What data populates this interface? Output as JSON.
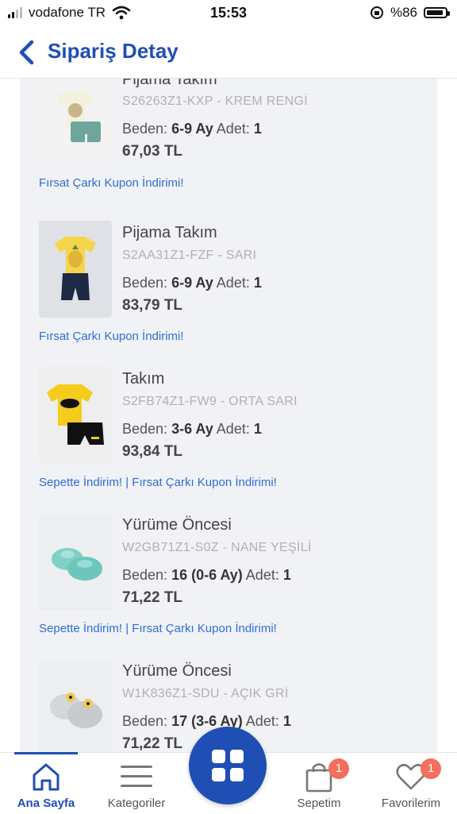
{
  "status_bar": {
    "carrier": "vodafone TR",
    "time": "15:53",
    "battery": "%86"
  },
  "header": {
    "title": "Sipariş Detay"
  },
  "labels": {
    "size": "Beden:",
    "qty": "Adet:"
  },
  "items": [
    {
      "name": "Pijama Takım",
      "sku": "S26263Z1-KXP - KREM RENGİ",
      "size": "6-9 Ay",
      "qty": "1",
      "price": "67,03 TL",
      "promo": "Fırsat Çarkı Kupon İndirimi!",
      "image": "pajama-cream"
    },
    {
      "name": "Pijama Takım",
      "sku": "S2AA31Z1-FZF - SARI",
      "size": "6-9 Ay",
      "qty": "1",
      "price": "83,79 TL",
      "promo": "Fırsat Çarkı Kupon İndirimi!",
      "image": "pajama-yellow"
    },
    {
      "name": "Takım",
      "sku": "S2FB74Z1-FW9 - ORTA SARI",
      "size": "3-6 Ay",
      "qty": "1",
      "price": "93,84 TL",
      "promo": "Sepette İndirim! | Fırsat Çarkı Kupon İndirimi!",
      "image": "batman-set"
    },
    {
      "name": "Yürüme Öncesi",
      "sku": "W2GB71Z1-S0Z - NANE YEŞİLİ",
      "size": "16 (0-6 Ay)",
      "qty": "1",
      "price": "71,22 TL",
      "promo": "Sepette İndirim! | Fırsat Çarkı Kupon İndirimi!",
      "image": "booties-mint"
    },
    {
      "name": "Yürüme Öncesi",
      "sku": "W1K836Z1-SDU - AÇIK GRİ",
      "size": "17 (3-6 Ay)",
      "qty": "1",
      "price": "71,22 TL",
      "promo": "",
      "image": "booties-grey"
    }
  ],
  "tabbar": {
    "home": "Ana Sayfa",
    "categories": "Kategoriler",
    "cart": "Sepetim",
    "cart_badge": "1",
    "favorites": "Favorilerim",
    "favorites_badge": "1"
  },
  "colors": {
    "brand_blue": "#1f4fb5",
    "promo_blue": "#2d6fd6",
    "badge": "#f36e5b"
  }
}
